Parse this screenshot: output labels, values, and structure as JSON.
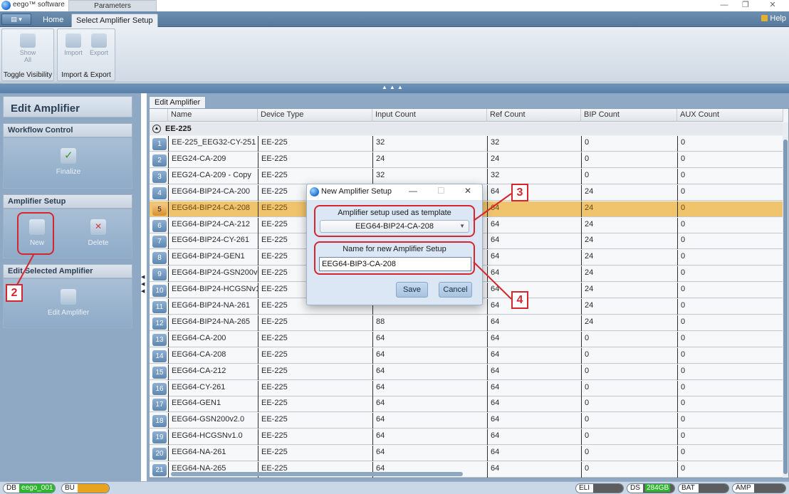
{
  "window": {
    "app_name": "eego™ software",
    "doc_tab": "Parameters",
    "minimize": "—",
    "restore": "❐",
    "close": "✕"
  },
  "ribbon_tabs": {
    "menu": "▤ ▾",
    "home": "Home",
    "select_setup": "Select Amplifier Setup",
    "help": "Help"
  },
  "ribbon": {
    "toggle_group_label": "Toggle Visibility",
    "show_all": "Show All",
    "import_export_label": "Import & Export",
    "import": "Import",
    "export": "Export",
    "grip": "▲▲▲"
  },
  "left_panel": {
    "title": "Edit Amplifier",
    "workflow_header": "Workflow Control",
    "finalize": "Finalize",
    "setup_header": "Amplifier Setup",
    "new": "New",
    "delete": "Delete",
    "edit_selected_header": "Edit Selected Amplifier",
    "edit_amplifier": "Edit Amplifier"
  },
  "grid": {
    "tab": "Edit Amplifier",
    "columns": [
      "Name",
      "Device Type",
      "Input Count",
      "Ref Count",
      "BIP Count",
      "AUX Count"
    ],
    "group": "EE-225",
    "rows": [
      {
        "n": "1",
        "name": "EE-225_EEG32-CY-251",
        "type": "EE-225",
        "input": "32",
        "ref": "32",
        "bip": "0",
        "aux": "0"
      },
      {
        "n": "2",
        "name": "EEG24-CA-209",
        "type": "EE-225",
        "input": "24",
        "ref": "24",
        "bip": "0",
        "aux": "0"
      },
      {
        "n": "3",
        "name": "EEG24-CA-209 - Copy",
        "type": "EE-225",
        "input": "32",
        "ref": "32",
        "bip": "0",
        "aux": "0"
      },
      {
        "n": "4",
        "name": "EEG64-BIP24-CA-200",
        "type": "EE-225",
        "input": "",
        "ref": "64",
        "bip": "24",
        "aux": "0"
      },
      {
        "n": "5",
        "name": "EEG64-BIP24-CA-208",
        "type": "EE-225",
        "input": "",
        "ref": "64",
        "bip": "24",
        "aux": "0"
      },
      {
        "n": "6",
        "name": "EEG64-BIP24-CA-212",
        "type": "EE-225",
        "input": "",
        "ref": "64",
        "bip": "24",
        "aux": "0"
      },
      {
        "n": "7",
        "name": "EEG64-BIP24-CY-261",
        "type": "EE-225",
        "input": "",
        "ref": "64",
        "bip": "24",
        "aux": "0"
      },
      {
        "n": "8",
        "name": "EEG64-BIP24-GEN1",
        "type": "EE-225",
        "input": "",
        "ref": "64",
        "bip": "24",
        "aux": "0"
      },
      {
        "n": "9",
        "name": "EEG64-BIP24-GSN200v2.0",
        "type": "EE-225",
        "input": "",
        "ref": "64",
        "bip": "24",
        "aux": "0"
      },
      {
        "n": "10",
        "name": "EEG64-BIP24-HCGSNv1.0",
        "type": "EE-225",
        "input": "",
        "ref": "64",
        "bip": "24",
        "aux": "0"
      },
      {
        "n": "11",
        "name": "EEG64-BIP24-NA-261",
        "type": "EE-225",
        "input": "",
        "ref": "64",
        "bip": "24",
        "aux": "0"
      },
      {
        "n": "12",
        "name": "EEG64-BIP24-NA-265",
        "type": "EE-225",
        "input": "88",
        "ref": "64",
        "bip": "24",
        "aux": "0"
      },
      {
        "n": "13",
        "name": "EEG64-CA-200",
        "type": "EE-225",
        "input": "64",
        "ref": "64",
        "bip": "0",
        "aux": "0"
      },
      {
        "n": "14",
        "name": "EEG64-CA-208",
        "type": "EE-225",
        "input": "64",
        "ref": "64",
        "bip": "0",
        "aux": "0"
      },
      {
        "n": "15",
        "name": "EEG64-CA-212",
        "type": "EE-225",
        "input": "64",
        "ref": "64",
        "bip": "0",
        "aux": "0"
      },
      {
        "n": "16",
        "name": "EEG64-CY-261",
        "type": "EE-225",
        "input": "64",
        "ref": "64",
        "bip": "0",
        "aux": "0"
      },
      {
        "n": "17",
        "name": "EEG64-GEN1",
        "type": "EE-225",
        "input": "64",
        "ref": "64",
        "bip": "0",
        "aux": "0"
      },
      {
        "n": "18",
        "name": "EEG64-GSN200v2.0",
        "type": "EE-225",
        "input": "64",
        "ref": "64",
        "bip": "0",
        "aux": "0"
      },
      {
        "n": "19",
        "name": "EEG64-HCGSNv1.0",
        "type": "EE-225",
        "input": "64",
        "ref": "64",
        "bip": "0",
        "aux": "0"
      },
      {
        "n": "20",
        "name": "EEG64-NA-261",
        "type": "EE-225",
        "input": "64",
        "ref": "64",
        "bip": "0",
        "aux": "0"
      },
      {
        "n": "21",
        "name": "EEG64-NA-265",
        "type": "EE-225",
        "input": "64",
        "ref": "64",
        "bip": "0",
        "aux": "0"
      }
    ],
    "selected_row": "5"
  },
  "dialog": {
    "title": "New Amplifier Setup",
    "template_label": "Amplifier setup used as template",
    "template_value": "EEG64-BIP24-CA-208",
    "name_label": "Name for new Amplifier Setup",
    "name_value": "EEG64-BIP3-CA-208",
    "save": "Save",
    "cancel": "Cancel",
    "minimize": "—",
    "maximize": "☐",
    "close": "✕"
  },
  "annotations": {
    "step2": "2",
    "step3": "3",
    "step4": "4",
    "color": "#d5262e"
  },
  "status_bar": {
    "db_label": "DB",
    "db_value": "eego_001",
    "bu_label": "BU",
    "eli_label": "ELI",
    "ds_label": "DS",
    "ds_value": "284GB",
    "bat_label": "BAT",
    "amp_label": "AMP",
    "green": "#2db52d",
    "orange": "#e8a31f",
    "gray": "#5d5d5d"
  }
}
